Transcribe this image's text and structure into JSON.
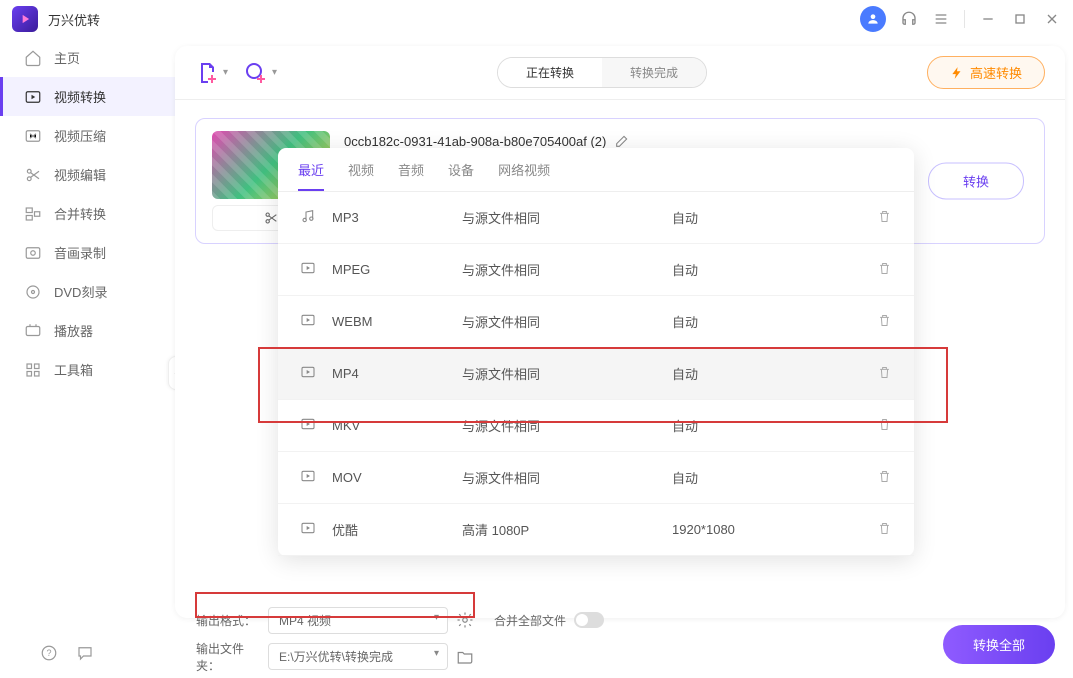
{
  "app_title": "万兴优转",
  "sidebar": {
    "items": [
      {
        "label": "主页"
      },
      {
        "label": "视频转换"
      },
      {
        "label": "视频压缩"
      },
      {
        "label": "视频编辑"
      },
      {
        "label": "合并转换"
      },
      {
        "label": "音画录制"
      },
      {
        "label": "DVD刻录"
      },
      {
        "label": "播放器"
      },
      {
        "label": "工具箱"
      }
    ]
  },
  "toolbar": {
    "tab_active": "正在转换",
    "tab_done": "转换完成",
    "fast": "高速转换"
  },
  "file": {
    "name": "0ccb182c-0931-41ab-908a-b80e705400af (2)",
    "convert": "转换"
  },
  "dd": {
    "tabs": [
      "最近",
      "视频",
      "音频",
      "设备",
      "网络视频"
    ],
    "rows": [
      {
        "name": "MP3",
        "res": "与源文件相同",
        "q": "自动"
      },
      {
        "name": "MPEG",
        "res": "与源文件相同",
        "q": "自动"
      },
      {
        "name": "WEBM",
        "res": "与源文件相同",
        "q": "自动"
      },
      {
        "name": "MP4",
        "res": "与源文件相同",
        "q": "自动"
      },
      {
        "name": "MKV",
        "res": "与源文件相同",
        "q": "自动"
      },
      {
        "name": "MOV",
        "res": "与源文件相同",
        "q": "自动"
      },
      {
        "name": "优酷",
        "res": "高清 1080P",
        "q": "1920*1080"
      }
    ]
  },
  "bottom": {
    "out_fmt_lbl": "输出格式：",
    "out_fmt_val": "MP4 视频",
    "merge_lbl": "合并全部文件",
    "out_dir_lbl": "输出文件夹：",
    "out_dir_val": "E:\\万兴优转\\转换完成",
    "convert_all": "转换全部"
  }
}
